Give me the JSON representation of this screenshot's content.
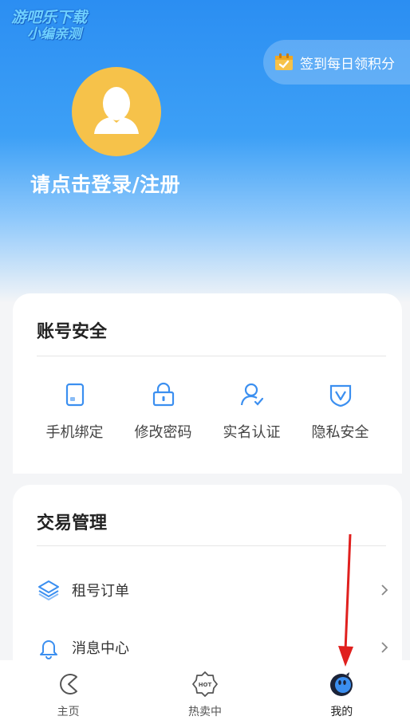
{
  "watermark": {
    "line1": "游吧乐下载",
    "line2": "小编亲测"
  },
  "signin": {
    "label": "签到每日领积分",
    "icon": "calendar-icon"
  },
  "profile": {
    "login_label": "请点击登录/注册",
    "avatar_icon": "user-avatar-icon"
  },
  "security": {
    "title": "账号安全",
    "items": [
      {
        "label": "手机绑定",
        "icon": "phone-icon"
      },
      {
        "label": "修改密码",
        "icon": "lock-icon"
      },
      {
        "label": "实名认证",
        "icon": "user-verify-icon"
      },
      {
        "label": "隐私安全",
        "icon": "shield-icon"
      }
    ]
  },
  "trade": {
    "title": "交易管理",
    "items": [
      {
        "label": "租号订单",
        "icon": "layers-icon"
      },
      {
        "label": "消息中心",
        "icon": "bell-icon"
      }
    ]
  },
  "tabbar": {
    "items": [
      {
        "label": "主页",
        "icon": "home-icon"
      },
      {
        "label": "热卖中",
        "icon": "hot-icon"
      },
      {
        "label": "我的",
        "icon": "profile-icon"
      }
    ],
    "active": "我的"
  },
  "colors": {
    "accent": "#3b8ff0",
    "avatar": "#f6c24a",
    "annotation": "#e0201e"
  }
}
